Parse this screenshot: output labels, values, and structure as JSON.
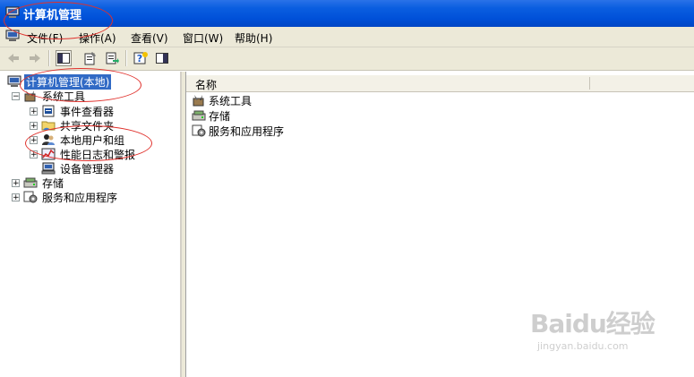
{
  "window": {
    "title": "计算机管理"
  },
  "menu": {
    "items": [
      {
        "label": "文件(F)"
      },
      {
        "label": "操作(A)"
      },
      {
        "label": "查看(V)"
      },
      {
        "label": "窗口(W)"
      },
      {
        "label": "帮助(H)"
      }
    ]
  },
  "toolbar": {
    "buttons": [
      "back-icon",
      "forward-icon",
      "show-hide-tree-icon",
      "properties-icon",
      "export-list-icon",
      "help-icon",
      "show-hide-action-pane-icon"
    ]
  },
  "tree": {
    "root": "计算机管理(本地)",
    "system_tools": "系统工具",
    "event_viewer": "事件查看器",
    "shared_folders": "共享文件夹",
    "local_users": "本地用户和组",
    "perf_logs": "性能日志和警报",
    "device_manager": "设备管理器",
    "storage": "存储",
    "services": "服务和应用程序"
  },
  "list": {
    "column_name": "名称",
    "rows": [
      "系统工具",
      "存储",
      "服务和应用程序"
    ]
  },
  "watermark": {
    "brand": "Baidu经验",
    "sub": "jingyan.baidu.com"
  },
  "colors": {
    "titlebar": "#0a5ee0",
    "selection": "#316ac5",
    "annotation": "#e0302b"
  }
}
